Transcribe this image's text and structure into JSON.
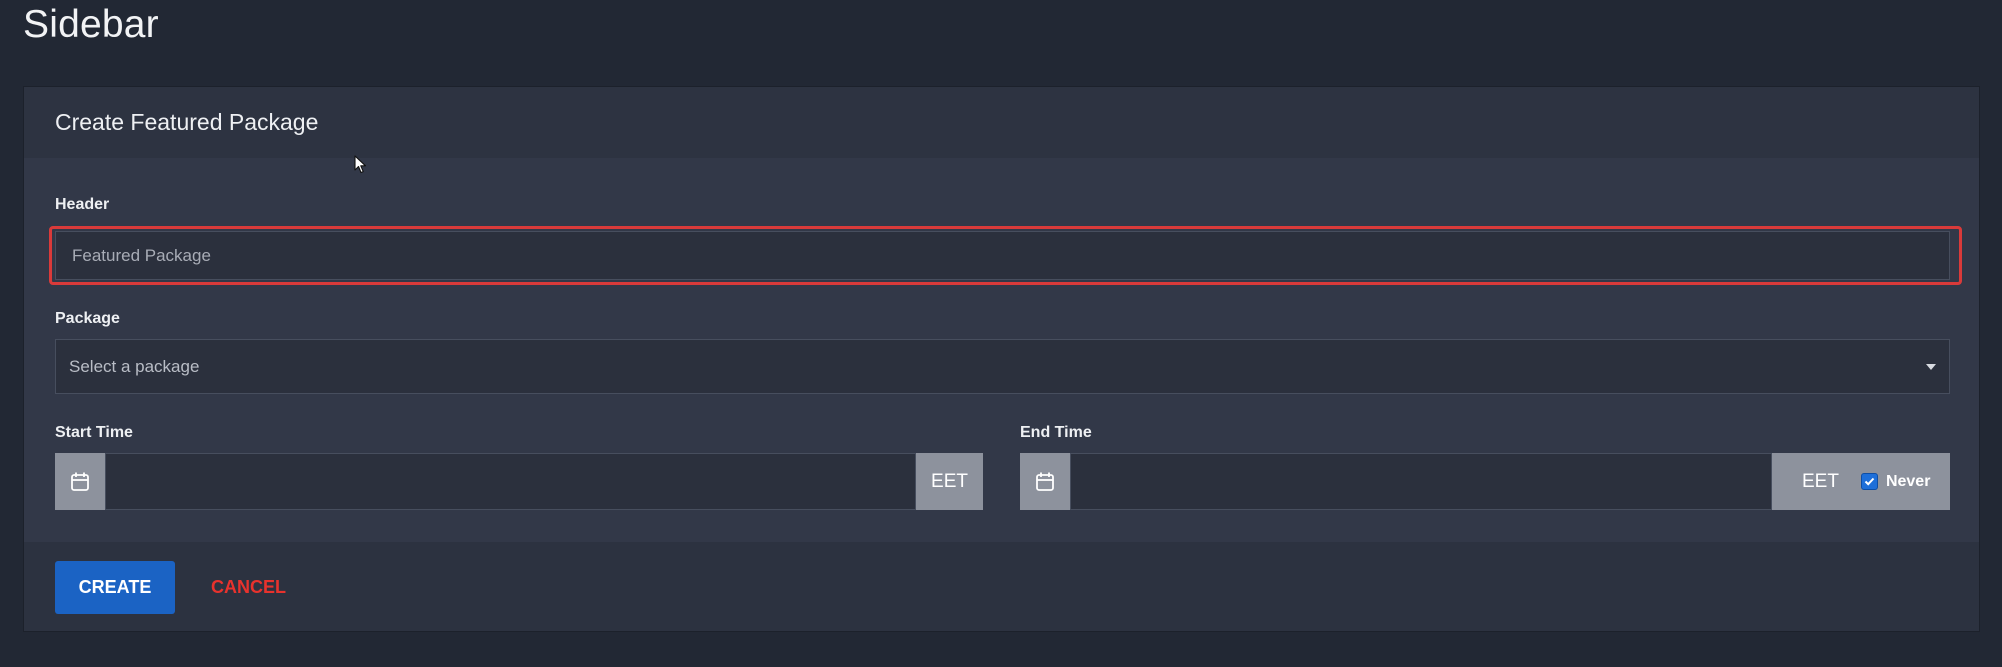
{
  "page": {
    "title": "Sidebar"
  },
  "card": {
    "title": "Create Featured Package"
  },
  "form": {
    "header": {
      "label": "Header",
      "placeholder": "Featured Package",
      "value": ""
    },
    "package": {
      "label": "Package",
      "selected": "Select a package"
    },
    "start_time": {
      "label": "Start Time",
      "value": "",
      "timezone": "EET"
    },
    "end_time": {
      "label": "End Time",
      "value": "",
      "timezone": "EET",
      "never_label": "Never",
      "never_checked": true
    }
  },
  "actions": {
    "create_label": "CREATE",
    "cancel_label": "CANCEL"
  },
  "colors": {
    "primary": "#1b63c4",
    "danger": "#e8322d",
    "highlight": "#d93a3a",
    "checkbox": "#1e6fd9"
  },
  "icons": {
    "calendar": "calendar-icon",
    "caret": "chevron-down-icon",
    "check": "check-icon",
    "cursor": "mouse-cursor-icon"
  }
}
